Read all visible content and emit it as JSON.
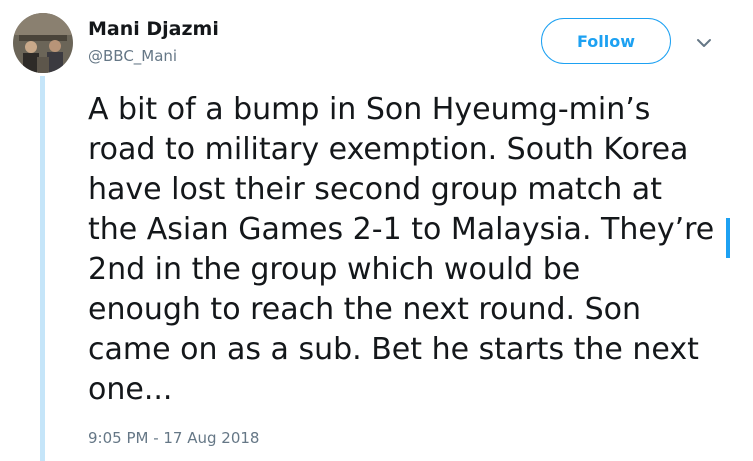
{
  "tweet": {
    "author_name": "Mani Djazmi",
    "author_handle": "@BBC_Mani",
    "follow_label": "Follow",
    "text_lines": [
      "A bit of a bump in Son Hyeumg-min’s",
      "road to military exemption. South Korea",
      "have lost their second group match at",
      "the Asian Games 2-1 to Malaysia. They’re",
      "2nd in the group which would be",
      "enough to reach the next round. Son",
      "came on as a sub. Bet he starts the next",
      "one..."
    ],
    "timestamp": "9:05 PM - 17 Aug 2018"
  },
  "icons": {
    "more": "chevron-down-icon",
    "avatar": "avatar-photo"
  },
  "colors": {
    "accent": "#1da1f2",
    "thread_line": "#c5e5f9",
    "text": "#14171a",
    "muted": "#657786"
  }
}
